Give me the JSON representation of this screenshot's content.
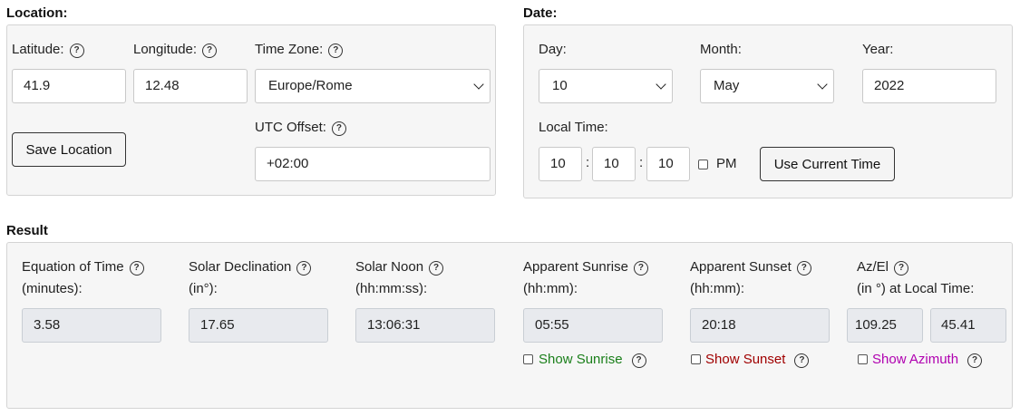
{
  "location": {
    "title": "Location:",
    "latitude_label": "Latitude:",
    "latitude_value": "41.9",
    "longitude_label": "Longitude:",
    "longitude_value": "12.48",
    "timezone_label": "Time Zone:",
    "timezone_value": "Europe/Rome",
    "save_button": "Save Location",
    "utc_label": "UTC Offset:",
    "utc_value": "+02:00"
  },
  "date": {
    "title": "Date:",
    "day_label": "Day:",
    "day_value": "10",
    "month_label": "Month:",
    "month_value": "May",
    "year_label": "Year:",
    "year_value": "2022",
    "local_time_label": "Local Time:",
    "hour": "10",
    "minute": "10",
    "second": "10",
    "colon": ":",
    "pm_label": "PM",
    "use_current_button": "Use Current Time"
  },
  "result": {
    "title": "Result",
    "eot_label_1": "Equation of Time",
    "eot_label_2": "(minutes):",
    "eot_value": "3.58",
    "decl_label_1": "Solar Declination",
    "decl_label_2": "(in°):",
    "decl_value": "17.65",
    "noon_label_1": "Solar Noon",
    "noon_label_2": "(hh:mm:ss):",
    "noon_value": "13:06:31",
    "sunrise_label_1": "Apparent Sunrise",
    "sunrise_label_2": "(hh:mm):",
    "sunrise_value": "05:55",
    "show_sunrise": "Show Sunrise",
    "sunset_label_1": "Apparent Sunset",
    "sunset_label_2": "(hh:mm):",
    "sunset_value": "20:18",
    "show_sunset": "Show Sunset",
    "azel_label_1": "Az/El",
    "azel_label_2": "(in °) at Local Time:",
    "az_value": "109.25",
    "el_value": "45.41",
    "show_azimuth": "Show Azimuth"
  },
  "help_glyph": "?",
  "icons": [
    "help-icon",
    "chevron-down-icon"
  ],
  "colors": {
    "sunrise": "#1a7f1a",
    "sunset": "#a00000",
    "azimuth": "#b000b0",
    "panel_bg": "#f6f6f6",
    "readonly_bg": "#e8eaee"
  }
}
